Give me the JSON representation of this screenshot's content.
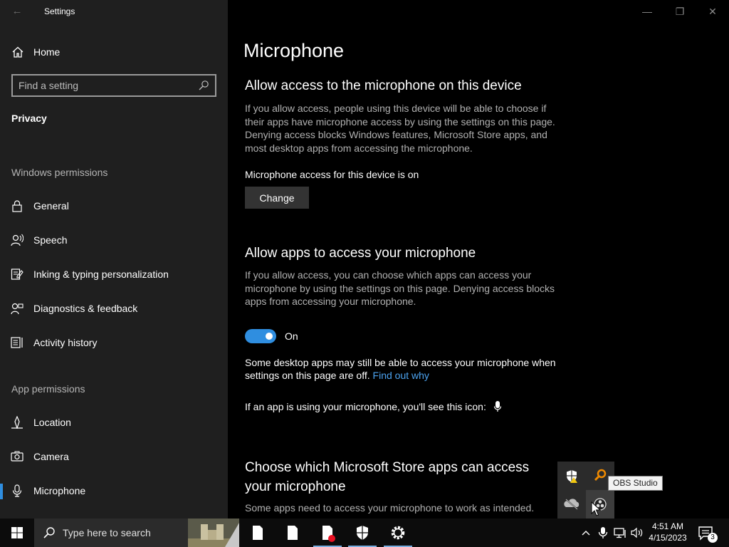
{
  "window": {
    "title": "Settings",
    "back_glyph": "←",
    "minimize_glyph": "—",
    "restore_glyph": "❐",
    "close_glyph": "✕"
  },
  "sidebar": {
    "home_label": "Home",
    "search_placeholder": "Find a setting",
    "section_title": "Privacy",
    "group_windows": "Windows permissions",
    "windows_items": [
      {
        "label": "General",
        "icon": "lock-icon"
      },
      {
        "label": "Speech",
        "icon": "speech-icon"
      },
      {
        "label": "Inking & typing personalization",
        "icon": "inking-icon"
      },
      {
        "label": "Diagnostics & feedback",
        "icon": "diagnostics-icon"
      },
      {
        "label": "Activity history",
        "icon": "activity-icon"
      }
    ],
    "group_apps": "App permissions",
    "app_items": [
      {
        "label": "Location",
        "icon": "location-icon"
      },
      {
        "label": "Camera",
        "icon": "camera-icon"
      },
      {
        "label": "Microphone",
        "icon": "microphone-icon",
        "active": true
      }
    ],
    "accent_color": "#2f8ee0"
  },
  "main": {
    "page_title": "Microphone",
    "device_section": {
      "heading": "Allow access to the microphone on this device",
      "description": "If you allow access, people using this device will be able to choose if their apps have microphone access by using the settings on this page. Denying access blocks Windows features, Microsoft Store apps, and most desktop apps from accessing the microphone.",
      "status": "Microphone access for this device is on",
      "button_label": "Change"
    },
    "apps_section": {
      "heading": "Allow apps to access your microphone",
      "description": "If you allow access, you can choose which apps can access your microphone by using the settings on this page. Denying access blocks apps from accessing your microphone.",
      "toggle_state": "On",
      "note": "Some desktop apps may still be able to access your microphone when settings on this page are off.",
      "note_link": "Find out why",
      "icon_note": "If an app is using your microphone, you'll see this icon:"
    },
    "store_section": {
      "heading": "Choose which Microsoft Store apps can access your microphone",
      "description": "Some apps need to access your microphone to work as intended."
    }
  },
  "tray_flyout": {
    "tooltip": "OBS Studio"
  },
  "taskbar": {
    "search_placeholder": "Type here to search",
    "time": "4:51 AM",
    "date": "4/15/2023",
    "notification_count": "3"
  }
}
